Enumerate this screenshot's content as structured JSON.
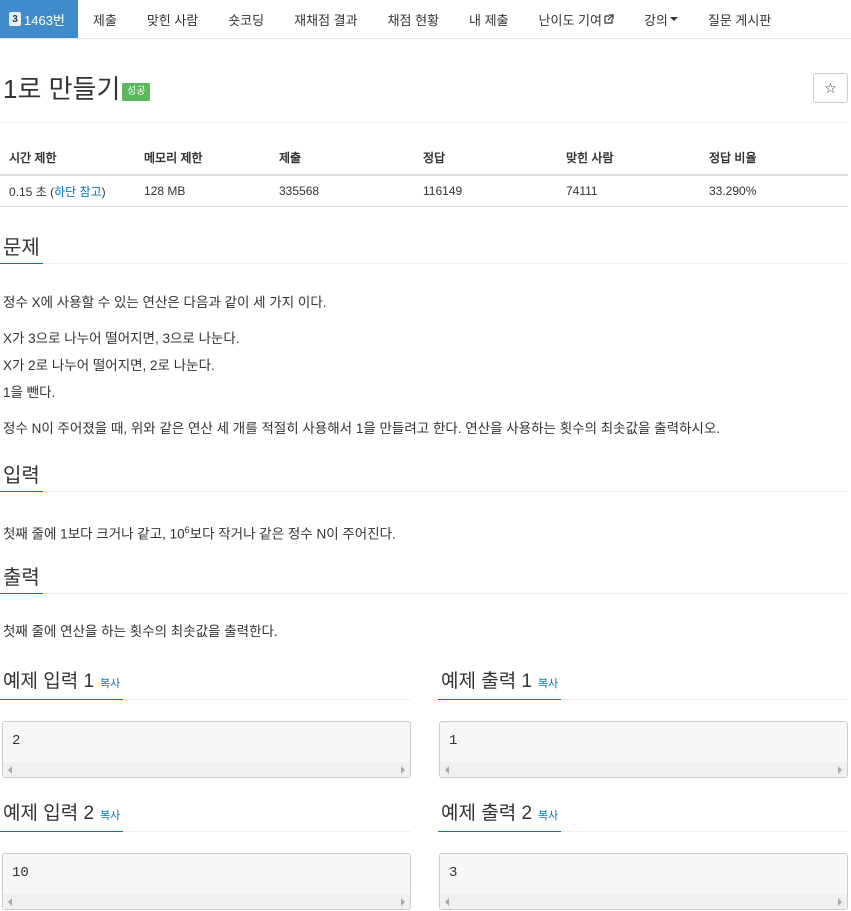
{
  "nav": {
    "active": {
      "level": "3",
      "label": "1463번"
    },
    "items": [
      "제출",
      "맞힌 사람",
      "숏코딩",
      "재채점 결과",
      "채점 현황",
      "내 제출",
      "난이도 기여",
      "강의",
      "질문 게시판"
    ]
  },
  "problem": {
    "title": "1로 만들기",
    "status_label": "성공",
    "star_icon": "☆"
  },
  "info_table": {
    "headers": [
      "시간 제한",
      "메모리 제한",
      "제출",
      "정답",
      "맞힌 사람",
      "정답 비율"
    ],
    "time_value": "0.15 초 (",
    "time_link": "하단 참고",
    "time_close": ")",
    "memory": "128 MB",
    "submissions": "335568",
    "accepted": "116149",
    "solvers": "74111",
    "ratio": "33.290%"
  },
  "sections": {
    "problem": {
      "heading": "문제",
      "intro": "정수 X에 사용할 수 있는 연산은 다음과 같이 세 가지 이다.",
      "ops": [
        "X가 3으로 나누어 떨어지면, 3으로 나눈다.",
        "X가 2로 나누어 떨어지면, 2로 나눈다.",
        "1을 뺀다."
      ],
      "desc": "정수 N이 주어졌을 때, 위와 같은 연산 세 개를 적절히 사용해서 1을 만들려고 한다. 연산을 사용하는 횟수의 최솟값을 출력하시오."
    },
    "input": {
      "heading": "입력",
      "text_a": "첫째 줄에 1보다 크거나 같고, 10",
      "text_sup": "6",
      "text_b": "보다 작거나 같은 정수 N이 주어진다."
    },
    "output": {
      "heading": "출력",
      "text": "첫째 줄에 연산을 하는 횟수의 최솟값을 출력한다."
    }
  },
  "examples": [
    {
      "in_title": "예제 입력 1",
      "out_title": "예제 출력 1",
      "copy": "복사",
      "input": "2",
      "output": "1"
    },
    {
      "in_title": "예제 입력 2",
      "out_title": "예제 출력 2",
      "copy": "복사",
      "input": "10",
      "output": "3"
    }
  ]
}
